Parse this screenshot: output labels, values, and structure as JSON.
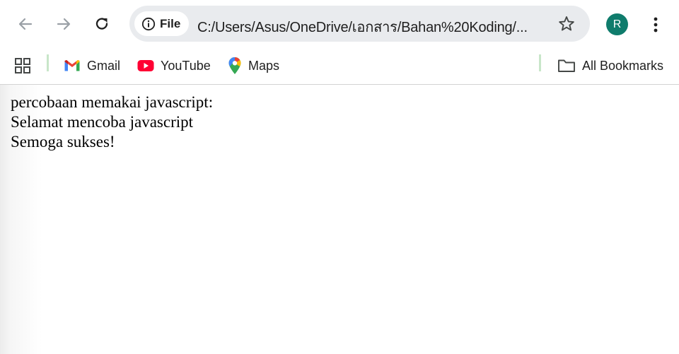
{
  "toolbar": {
    "back_icon": "arrow-left-icon",
    "forward_icon": "arrow-right-icon",
    "reload_icon": "reload-icon",
    "site_info_label": "File",
    "url": "C:/Users/Asus/OneDrive/เอกสาร/Bahan%20Koding/...",
    "bookmark_star_icon": "star-icon",
    "avatar_letter": "R",
    "avatar_color": "#0f7c6c",
    "menu_icon": "kebab-menu-icon"
  },
  "bookmarks": {
    "apps_icon": "apps-grid-icon",
    "items": [
      {
        "label": "Gmail",
        "icon": "gmail-icon"
      },
      {
        "label": "YouTube",
        "icon": "youtube-icon"
      },
      {
        "label": "Maps",
        "icon": "maps-icon"
      }
    ],
    "all_bookmarks_label": "All Bookmarks",
    "all_bookmarks_icon": "folder-icon"
  },
  "page": {
    "lines": [
      "percobaan memakai javascript:",
      "Selamat mencoba javascript",
      "Semoga sukses!"
    ]
  }
}
